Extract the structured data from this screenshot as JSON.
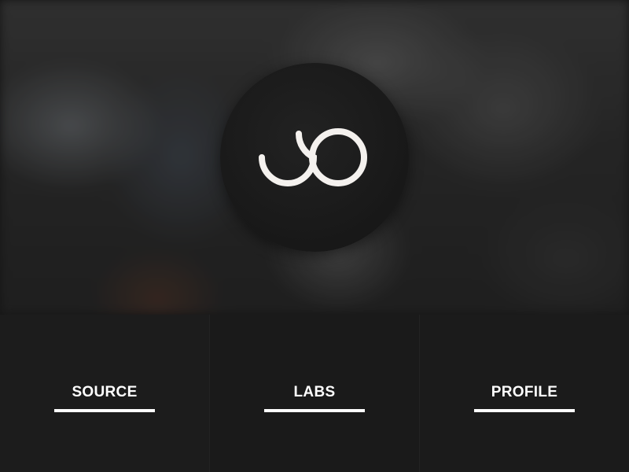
{
  "logo": {
    "icon": "infinity-swirl-icon",
    "circle_color": "#1c1c1c",
    "mark_color": "#f4f1ee"
  },
  "nav": {
    "items": [
      {
        "label": "SOURCE"
      },
      {
        "label": "LABS"
      },
      {
        "label": "PROFILE"
      }
    ],
    "text_color": "#ffffff",
    "underline_color": "#ffffff"
  }
}
